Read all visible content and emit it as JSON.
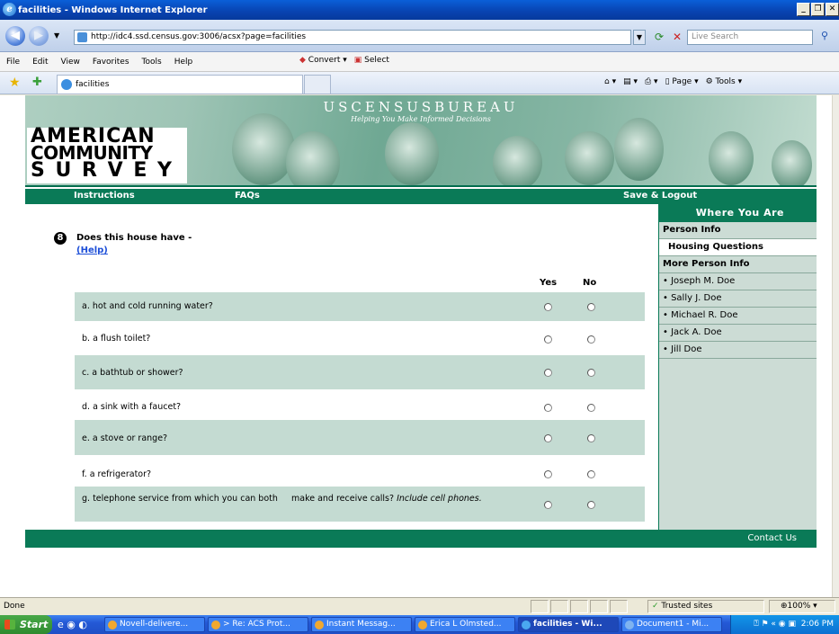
{
  "window": {
    "title": "facilities - Windows Internet Explorer",
    "minimize": "_",
    "maximize": "❐",
    "close": "✕"
  },
  "address": {
    "url": "http://idc4.ssd.census.gov:3006/acsx?page=facilities",
    "search_placeholder": "Live Search"
  },
  "menu": [
    "File",
    "Edit",
    "View",
    "Favorites",
    "Tools",
    "Help"
  ],
  "toolbar": {
    "convert": "Convert",
    "select": "Select"
  },
  "tab": {
    "label": "facilities"
  },
  "commandbar": {
    "page": "Page",
    "tools": "Tools"
  },
  "banner": {
    "census_title": "USCENSUSBUREAU",
    "census_subtitle": "Helping You Make Informed Decisions",
    "logo_line1": "AMERICAN",
    "logo_line2": "COMMUNITY",
    "logo_line3": "S U R V E Y"
  },
  "nav": {
    "instructions": "Instructions",
    "faqs": "FAQs",
    "save_logout": "Save & Logout"
  },
  "question": {
    "number": "8",
    "text": "Does this house have -",
    "help": "(Help)",
    "yes_header": "Yes",
    "no_header": "No",
    "items": [
      {
        "label": "a. hot and cold running water?"
      },
      {
        "label": "b. a flush toilet?"
      },
      {
        "label": "c. a bathtub or shower?"
      },
      {
        "label": "d. a sink with a faucet?"
      },
      {
        "label": "e. a stove or range?"
      },
      {
        "label": "f. a refrigerator?"
      },
      {
        "label": "g. telephone service from which you can both     make and receive calls?",
        "note": "Include cell phones."
      }
    ]
  },
  "sidebar": {
    "heading": "Where You Are",
    "sections": [
      {
        "label": "Person Info",
        "kind": "hdr"
      },
      {
        "label": "Housing Questions",
        "kind": "active"
      },
      {
        "label": "More Person Info",
        "kind": "hdr"
      }
    ],
    "people": [
      "• Joseph M. Doe",
      "• Sally J. Doe",
      "• Michael R. Doe",
      "• Jack A. Doe",
      "• Jill Doe"
    ]
  },
  "footer": {
    "contact": "Contact Us"
  },
  "status": {
    "left": "Done",
    "zone": "Trusted sites",
    "zoom": "100%"
  },
  "taskbar": {
    "start": "Start",
    "tasks": [
      "Novell-delivere...",
      "> Re: ACS Prot...",
      "Instant Messag...",
      "Erica L Olmsted...",
      "facilities - Wi...",
      "Document1 - Mi..."
    ],
    "clock": "2:06 PM"
  },
  "colors": {
    "accent_green": "#0a7a57",
    "row_shade": "#c4dbd2",
    "sidebar_bg": "#ccdcd5"
  }
}
